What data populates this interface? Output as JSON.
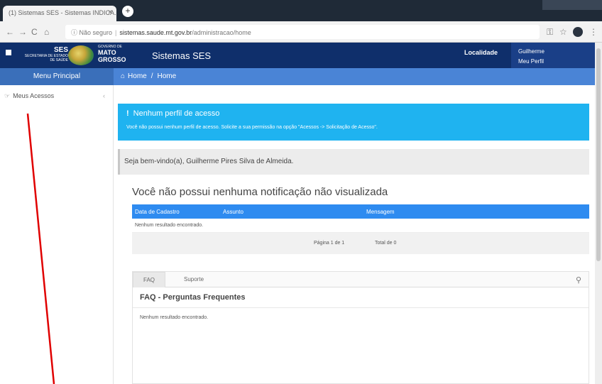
{
  "browser": {
    "tab_title": "(1) Sistemas SES - Sistemas INDICA...",
    "tab_close": "×",
    "new_tab": "+",
    "nav_back": "←",
    "nav_forward": "→",
    "nav_reload": "C",
    "nav_home": "⌂",
    "security": "ⓘ Não seguro",
    "url_host": "sistemas.saude.mt.gov.br",
    "url_path": "/administracao/home",
    "key_icon": "⚿",
    "star_icon": "☆",
    "menu_icon": "⋮"
  },
  "header": {
    "ses_big": "SES",
    "ses_small": "SECRETARIA DE ESTADO DE SAÚDE",
    "gov_small": "GOVERNO DE",
    "gov_line1": "MATO",
    "gov_line2": "GROSSO",
    "app_title": "Sistemas SES",
    "localidade": "Localidade",
    "user_line1": "Guilherme",
    "user_line2": "Meu Perfil"
  },
  "subnav": {
    "menu_principal": "Menu Principal",
    "home_icon": "⌂",
    "crumb1": "Home",
    "crumb_sep": "/",
    "crumb2": "Home"
  },
  "sidebar": {
    "item_icon": "☞",
    "item_label": "Meus Acessos",
    "item_chevron": "‹"
  },
  "alert": {
    "icon": "!",
    "title": "Nenhum perfil de acesso",
    "message": "Você não possui nenhum perfil de acesso. Solicite a sua permissão na opção \"Acessos -> Solicitação de Acesso\"."
  },
  "welcome": "Seja bem-vindo(a), Guilherme Pires Silva de Almeida.",
  "notifications": {
    "title": "Você não possui nenhuma notificação não visualizada",
    "columns": [
      "Data de Cadastro",
      "Assunto",
      "Mensagem"
    ],
    "empty": "Nenhum resultado encontrado.",
    "page_info": "Página 1 de 1",
    "total_info": "Total de 0"
  },
  "faq": {
    "tabs": [
      "FAQ",
      "Suporte"
    ],
    "search_icon": "⚲",
    "heading": "FAQ - Perguntas Frequentes",
    "empty": "Nenhum resultado encontrado."
  },
  "colors": {
    "header_bg": "#0f2f6b",
    "subnav_bg": "#4a84d6",
    "alert_bg": "#1fb3f0",
    "table_head_bg": "#2e8bf0",
    "annotation": "#e00000"
  }
}
